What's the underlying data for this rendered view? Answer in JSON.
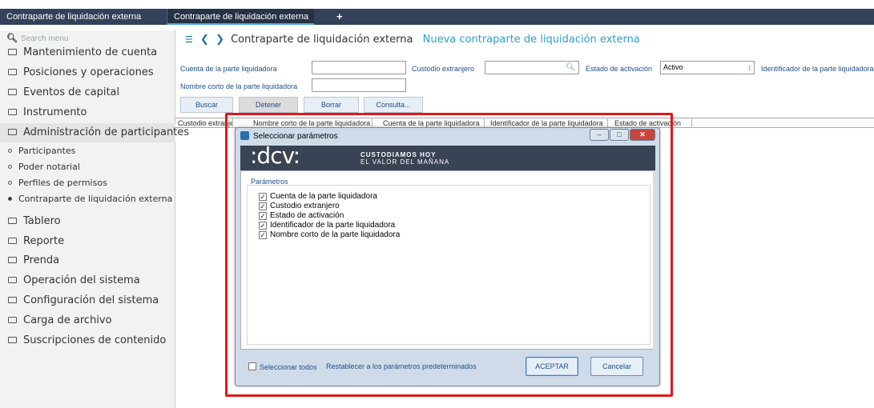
{
  "tabs": [
    {
      "label": "Contraparte de liquidación externa"
    },
    {
      "label": "Contraparte de liquidación externa"
    },
    {
      "label": "+"
    }
  ],
  "sidebar": {
    "search_placeholder": "Search menu",
    "items": [
      {
        "label": "Mantenimiento de cuenta"
      },
      {
        "label": "Posiciones y operaciones"
      },
      {
        "label": "Eventos de capital"
      },
      {
        "label": "Instrumento"
      },
      {
        "label": "Administración de participantes"
      },
      {
        "label": "Tablero"
      },
      {
        "label": "Reporte"
      },
      {
        "label": "Prenda"
      },
      {
        "label": "Operación del sistema"
      },
      {
        "label": "Configuración del sistema"
      },
      {
        "label": "Carga de archivo"
      },
      {
        "label": "Suscripciones de contenido"
      }
    ],
    "subitems": [
      {
        "label": "Participantes"
      },
      {
        "label": "Poder notarial"
      },
      {
        "label": "Perfiles de permisos"
      },
      {
        "label": "Contraparte de liquidación externa"
      }
    ]
  },
  "breadcrumb": {
    "title": "Contraparte de liquidación externa",
    "link": "Nueva contraparte de liquidación externa"
  },
  "form": {
    "cuenta_label": "Cuenta de la parte liquidadora",
    "custodio_label": "Custodio extranjero",
    "estado_label": "Estado de activación",
    "estado_value": "Activo",
    "identificador_label": "Identificador de la parte liquidadora",
    "nombre_label": "Nombre corto de la parte liquidadora"
  },
  "buttons": {
    "buscar": "Buscar",
    "detener": "Detener",
    "borrar": "Borrar",
    "consulta": "Consulta..."
  },
  "grid": {
    "headers": [
      "Custodio extranjero",
      "Nombre corto de la parte liquidadora",
      "Cuenta de la parte liquidadora",
      "Identificador de la parte liquidadora",
      "Estado de activación"
    ]
  },
  "dialog": {
    "title": "Seleccionar parámetros",
    "logo": ":dcv:",
    "slogan_line1": "CUSTODIAMOS HOY",
    "slogan_line2": "EL VALOR DEL MAÑANA",
    "params_title": "Parámetros",
    "params": [
      {
        "label": "Cuenta de la parte liquidadora",
        "checked": true
      },
      {
        "label": "Custodio extranjero",
        "checked": true
      },
      {
        "label": "Estado de activación",
        "checked": true
      },
      {
        "label": "Identificador de la parte liquidadora",
        "checked": true
      },
      {
        "label": "Nombre corto de la parte liquidadora",
        "checked": true
      }
    ],
    "select_all": "Seleccionar todos",
    "restore": "Restablecer a los parámetros predeterminados",
    "accept": "ACEPTAR",
    "cancel": "Cancelar"
  },
  "colors": {
    "tabbar": "#33415a",
    "highlight": "#e01818",
    "link": "#2aa0c8"
  }
}
